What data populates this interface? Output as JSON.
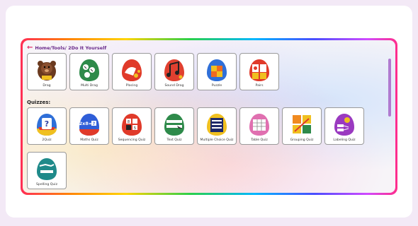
{
  "breadcrumb": {
    "path": "Home/Tools/ 2Do It Yourself"
  },
  "section_quizzes": "Quizzes:",
  "tools": [
    {
      "label": "Drag",
      "icon": "bear-icon"
    },
    {
      "label": "Multi Drag",
      "icon": "multi-drag-icon"
    },
    {
      "label": "Placing",
      "icon": "placing-icon"
    },
    {
      "label": "Sound Drag",
      "icon": "sound-drag-icon"
    },
    {
      "label": "Puzzle",
      "icon": "puzzle-icon"
    },
    {
      "label": "Pairs",
      "icon": "pairs-icon"
    }
  ],
  "quizzes": [
    {
      "label": "2Quiz",
      "icon": "question-icon"
    },
    {
      "label": "Maths Quiz",
      "icon": "maths-icon"
    },
    {
      "label": "Sequencing Quiz",
      "icon": "sequencing-icon"
    },
    {
      "label": "Text Quiz",
      "icon": "text-quiz-icon"
    },
    {
      "label": "Multiple Choice Quiz",
      "icon": "multiple-choice-icon"
    },
    {
      "label": "Table Quiz",
      "icon": "table-icon"
    },
    {
      "label": "Grouping Quiz",
      "icon": "grouping-icon"
    },
    {
      "label": "Labeling Quiz",
      "icon": "labeling-icon"
    },
    {
      "label": "Spelling Quiz",
      "icon": "spelling-icon"
    }
  ]
}
